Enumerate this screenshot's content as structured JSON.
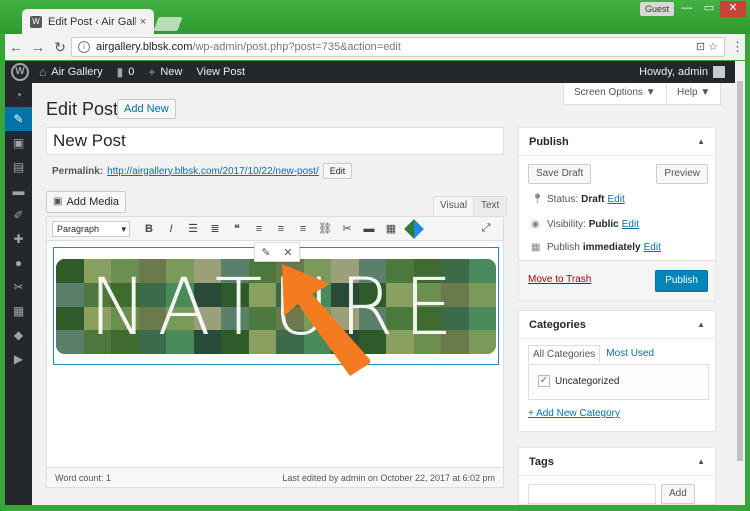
{
  "browser": {
    "tab_title": "Edit Post ‹ Air Gallery —",
    "tab_close": "×",
    "guest_label": "Guest",
    "url_host": "airgallery.blbsk.com",
    "url_path": "/wp-admin/post.php?post=735&action=edit",
    "minimize": "—",
    "maximize": "▭",
    "close": "✕"
  },
  "adminbar": {
    "site_name": "Air Gallery",
    "comments_count": "0",
    "new_label": "New",
    "view_post": "View Post",
    "howdy": "Howdy, admin"
  },
  "admin_menu_icons": [
    "dashboard-icon",
    "posts-icon",
    "media-icon",
    "pages-icon",
    "comments-icon",
    "appearance-icon",
    "plugins-icon",
    "users-icon",
    "tools-icon",
    "settings-icon",
    "gallery-icon",
    "play-icon"
  ],
  "header": {
    "screen_options": "Screen Options ▼",
    "help": "Help ▼",
    "page_title": "Edit Post",
    "add_new": "Add New"
  },
  "post": {
    "title": "New Post",
    "permalink_label": "Permalink:",
    "permalink_url": "http://airgallery.blbsk.com/2017/10/22/new-post/",
    "permalink_edit": "Edit"
  },
  "editor": {
    "add_media": "Add Media",
    "tab_visual": "Visual",
    "tab_text": "Text",
    "format": "Paragraph",
    "image_text": "NATURE",
    "word_count": "Word count: 1",
    "last_edited": "Last edited by admin on October 22, 2017 at 6:02 pm"
  },
  "publish": {
    "heading": "Publish",
    "save_draft": "Save Draft",
    "preview": "Preview",
    "status_label": "Status:",
    "status_value": "Draft",
    "visibility_label": "Visibility:",
    "visibility_value": "Public",
    "schedule_label": "Publish",
    "schedule_value": "immediately",
    "edit": "Edit",
    "trash": "Move to Trash",
    "publish_button": "Publish"
  },
  "categories": {
    "heading": "Categories",
    "tab_all": "All Categories",
    "tab_used": "Most Used",
    "items": [
      {
        "label": "Uncategorized",
        "checked": true
      }
    ],
    "add_new": "+ Add New Category"
  },
  "tags": {
    "heading": "Tags",
    "add": "Add"
  },
  "colors": {
    "accent": "#0073aa",
    "publish_button": "#0085ba",
    "arrow": "#f47b20",
    "adminbar": "#23282d"
  }
}
